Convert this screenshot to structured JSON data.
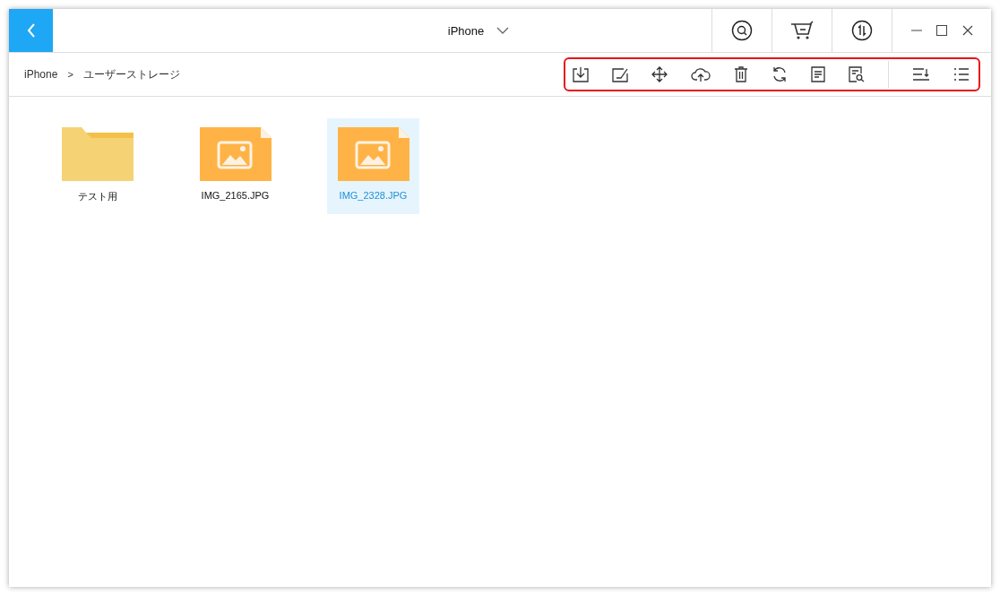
{
  "window": {
    "title": "iPhone"
  },
  "breadcrumb": {
    "items": [
      "iPhone",
      "ユーザーストレージ"
    ],
    "separator": ">"
  },
  "files": [
    {
      "name": "テスト用",
      "kind": "folder",
      "selected": false
    },
    {
      "name": "IMG_2165.JPG",
      "kind": "image",
      "selected": false
    },
    {
      "name": "IMG_2328.JPG",
      "kind": "image",
      "selected": true
    }
  ]
}
